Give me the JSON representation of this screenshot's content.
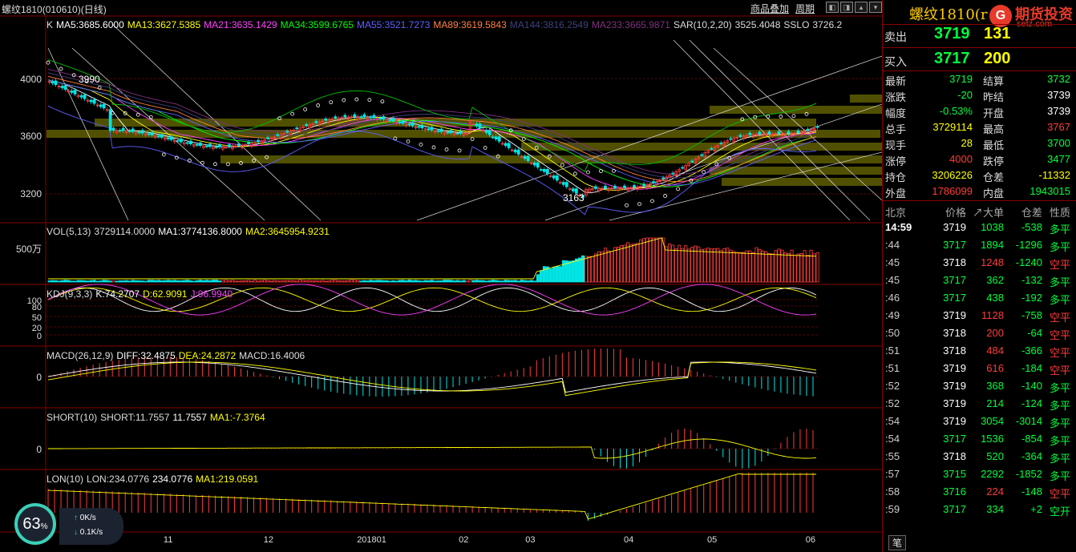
{
  "window": {
    "title": "螺纹1810(010610)(日线)",
    "links": [
      "商品叠加",
      "周期"
    ],
    "icons": [
      "arrow-left-icon",
      "arrow-right-icon",
      "arrow-up-icon",
      "arrow-down-icon"
    ]
  },
  "colors": {
    "up": "#ff3b3b",
    "down": "#00e5e5",
    "green": "#00ff3c",
    "yellow": "#ffff00",
    "white": "#ffffff",
    "accent": "#ffcc00"
  },
  "main": {
    "legend": [
      {
        "text": "K",
        "color": "#dddddd"
      },
      {
        "text": "MA5:3685.6000",
        "color": "#ffffff"
      },
      {
        "text": "MA13:3627.5385",
        "color": "#ffff00"
      },
      {
        "text": "MA21:3635.1429",
        "color": "#ff40ff"
      },
      {
        "text": "MA34:3599.6765",
        "color": "#00ff00"
      },
      {
        "text": "MA55:3521.7273",
        "color": "#6060ff"
      },
      {
        "text": "MA89:3619.5843",
        "color": "#ff8040"
      },
      {
        "text": "MA144:3816.2549",
        "color": "#404080"
      },
      {
        "text": "MA233:3665.9871",
        "color": "#803080"
      },
      {
        "text": "SAR(10,2,20)",
        "color": "#dddddd"
      },
      {
        "text": "3525.4048",
        "color": "#dddddd"
      },
      {
        "text": "SSLO",
        "color": "#dddddd"
      },
      {
        "text": "3726.2",
        "color": "#dddddd"
      }
    ],
    "yticks": [
      "4000",
      "3600",
      "3200"
    ],
    "annotations": {
      "high": "3990",
      "low": "3163"
    }
  },
  "vol": {
    "legend": [
      {
        "text": "VOL(5,13)",
        "color": "#dddddd"
      },
      {
        "text": "3729114.0000",
        "color": "#dddddd"
      },
      {
        "text": "MA1:3774136.8000",
        "color": "#ffffff"
      },
      {
        "text": "MA2:3645954.9231",
        "color": "#ffff00"
      }
    ],
    "ytick": "500万"
  },
  "kdj": {
    "legend": [
      {
        "text": "KDJ(9,3,3)",
        "color": "#dddddd"
      },
      {
        "text": "K:74.2707",
        "color": "#ffffff"
      },
      {
        "text": "D:62.9091",
        "color": "#ffff00"
      },
      {
        "text": "J:96.9940",
        "color": "#ff40ff"
      }
    ],
    "yticks": [
      "100",
      "80",
      "50",
      "20",
      "0"
    ]
  },
  "macd": {
    "legend": [
      {
        "text": "MACD(26,12,9)",
        "color": "#dddddd"
      },
      {
        "text": "DIFF:32.4875",
        "color": "#ffffff"
      },
      {
        "text": "DEA:24.2872",
        "color": "#ffff00"
      },
      {
        "text": "MACD:16.4006",
        "color": "#dddddd"
      }
    ],
    "ytick": "0"
  },
  "short": {
    "legend": [
      {
        "text": "SHORT(10)",
        "color": "#dddddd"
      },
      {
        "text": "SHORT:11.7557",
        "color": "#dddddd"
      },
      {
        "text": "11.7557",
        "color": "#ffffff"
      },
      {
        "text": "MA1:-7.3764",
        "color": "#ffff00"
      }
    ],
    "ytick": "0"
  },
  "lon": {
    "legend": [
      {
        "text": "LON(10)",
        "color": "#dddddd"
      },
      {
        "text": "LON:234.0776",
        "color": "#dddddd"
      },
      {
        "text": "234.0776",
        "color": "#ffffff"
      },
      {
        "text": "MA1:219.0591",
        "color": "#ffff00"
      }
    ]
  },
  "xaxis": [
    {
      "label": "11",
      "pos": 0.148
    },
    {
      "label": "12",
      "pos": 0.268
    },
    {
      "label": "201801",
      "pos": 0.38
    },
    {
      "label": "02",
      "pos": 0.502
    },
    {
      "label": "03",
      "pos": 0.582
    },
    {
      "label": "04",
      "pos": 0.7
    },
    {
      "label": "05",
      "pos": 0.8
    },
    {
      "label": "06",
      "pos": 0.918
    }
  ],
  "network": {
    "percent": "63",
    "unit": "%",
    "up": "0K/s",
    "down": "0.1K/s"
  },
  "panel": {
    "title": "螺纹1810(r",
    "logo": {
      "badge": "G",
      "name": "期货投资",
      "url": "setz.com"
    },
    "ask": {
      "label": "卖出",
      "price": "3719",
      "vol": "131"
    },
    "bid": {
      "label": "买入",
      "price": "3717",
      "vol": "200"
    },
    "quotes": [
      {
        "l": "最新",
        "v": "3719",
        "vc": "#00ff3c",
        "l2": "结算",
        "v2": "3732",
        "v2c": "#00ff3c"
      },
      {
        "l": "涨跌",
        "v": "-20",
        "vc": "#00ff3c",
        "l2": "昨结",
        "v2": "3739",
        "v2c": "#ffffff"
      },
      {
        "l": "幅度",
        "v": "-0.53%",
        "vc": "#00ff3c",
        "l2": "开盘",
        "v2": "3739",
        "v2c": "#ffffff"
      },
      {
        "l": "总手",
        "v": "3729114",
        "vc": "#ffff00",
        "l2": "最高",
        "v2": "3767",
        "v2c": "#ff3b3b"
      },
      {
        "l": "现手",
        "v": "28",
        "vc": "#ffff00",
        "l2": "最低",
        "v2": "3700",
        "v2c": "#00ff3c"
      },
      {
        "l": "涨停",
        "v": "4000",
        "vc": "#ff3b3b",
        "l2": "跌停",
        "v2": "3477",
        "v2c": "#00ff3c"
      },
      {
        "l": "持仓",
        "v": "3206226",
        "vc": "#ffff00",
        "l2": "仓差",
        "v2": "-11332",
        "v2c": "#ffff00"
      },
      {
        "l": "外盘",
        "v": "1786099",
        "vc": "#ff3b3b",
        "l2": "内盘",
        "v2": "1943015",
        "v2c": "#00ff3c"
      }
    ],
    "trades_header": [
      "北京",
      "价格",
      "↗大单",
      "仓差",
      "性质"
    ],
    "trades": [
      {
        "t": "14:59",
        "p": "3719",
        "v": "1038",
        "d": "-538",
        "n": "多平",
        "c": "#00ff3c"
      },
      {
        "t": ":44",
        "p": "3717",
        "v": "1894",
        "d": "-1296",
        "n": "多平",
        "c": "#00ff3c"
      },
      {
        "t": ":45",
        "p": "3718",
        "v": "1248",
        "d": "-1240",
        "n": "空平",
        "c": "#ff3b3b"
      },
      {
        "t": ":45",
        "p": "3717",
        "v": "362",
        "d": "-132",
        "n": "多平",
        "c": "#00ff3c"
      },
      {
        "t": ":46",
        "p": "3717",
        "v": "438",
        "d": "-192",
        "n": "多平",
        "c": "#00ff3c"
      },
      {
        "t": ":49",
        "p": "3719",
        "v": "1128",
        "d": "-758",
        "n": "空平",
        "c": "#ff3b3b"
      },
      {
        "t": ":50",
        "p": "3718",
        "v": "200",
        "d": "-64",
        "n": "空平",
        "c": "#ff3b3b"
      },
      {
        "t": ":51",
        "p": "3718",
        "v": "484",
        "d": "-366",
        "n": "空平",
        "c": "#ff3b3b"
      },
      {
        "t": ":51",
        "p": "3719",
        "v": "616",
        "d": "-184",
        "n": "空平",
        "c": "#ff3b3b"
      },
      {
        "t": ":52",
        "p": "3719",
        "v": "368",
        "d": "-140",
        "n": "多平",
        "c": "#00ff3c"
      },
      {
        "t": ":52",
        "p": "3719",
        "v": "214",
        "d": "-124",
        "n": "多平",
        "c": "#00ff3c"
      },
      {
        "t": ":54",
        "p": "3719",
        "v": "3054",
        "d": "-3014",
        "n": "多平",
        "c": "#00ff3c"
      },
      {
        "t": ":54",
        "p": "3717",
        "v": "1536",
        "d": "-854",
        "n": "多平",
        "c": "#00ff3c"
      },
      {
        "t": ":55",
        "p": "3718",
        "v": "520",
        "d": "-364",
        "n": "多平",
        "c": "#00ff3c"
      },
      {
        "t": ":57",
        "p": "3715",
        "v": "2292",
        "d": "-1852",
        "n": "多平",
        "c": "#00ff3c"
      },
      {
        "t": ":58",
        "p": "3716",
        "v": "224",
        "d": "-148",
        "n": "空平",
        "c": "#ff3b3b"
      },
      {
        "t": ":59",
        "p": "3717",
        "v": "334",
        "d": "+2",
        "n": "空开",
        "c": "#00ff3c"
      }
    ],
    "bottom_tab": "笔"
  }
}
